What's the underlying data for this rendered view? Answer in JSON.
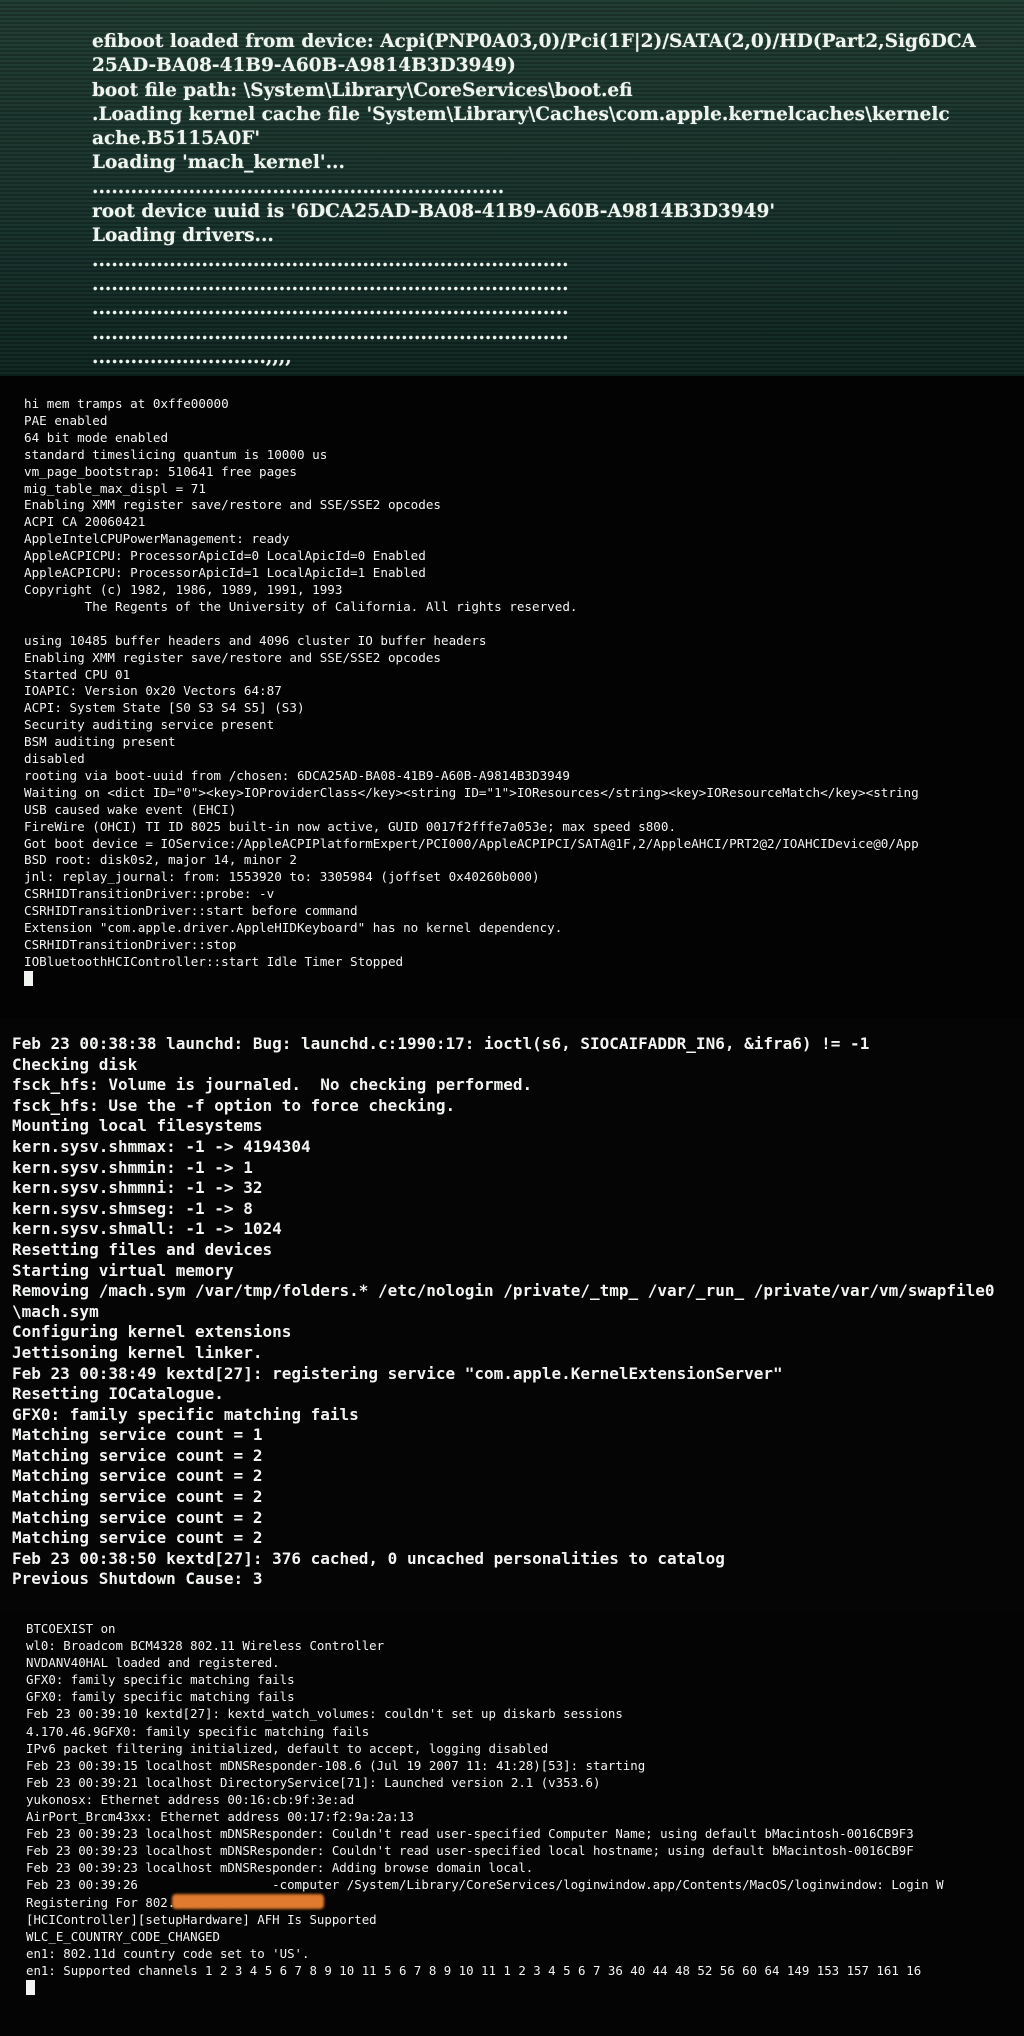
{
  "efi_boot": {
    "lines": [
      "efiboot loaded from device: Acpi(PNP0A03,0)/Pci(1F|2)/SATA(2,0)/HD(Part2,Sig6DCA",
      "25AD-BA08-41B9-A60B-A9814B3D3949)",
      "boot file path: \\System\\Library\\CoreServices\\boot.efi",
      ".Loading kernel cache file 'System\\Library\\Caches\\com.apple.kernelcaches\\kernelc",
      "ache.B5115A0F'",
      "Loading 'mach_kernel'...",
      "................................................................",
      "root device uuid is '6DCA25AD-BA08-41B9-A60B-A9814B3D3949'",
      "Loading drivers...",
      "..........................................................................",
      "..........................................................................",
      "..........................................................................",
      "..........................................................................",
      "...........................,,,,"
    ]
  },
  "kernel_log": {
    "lines": [
      "hi mem tramps at 0xffe00000",
      "PAE enabled",
      "64 bit mode enabled",
      "standard timeslicing quantum is 10000 us",
      "vm_page_bootstrap: 510641 free pages",
      "mig_table_max_displ = 71",
      "Enabling XMM register save/restore and SSE/SSE2 opcodes",
      "ACPI CA 20060421",
      "AppleIntelCPUPowerManagement: ready",
      "AppleACPICPU: ProcessorApicId=0 LocalApicId=0 Enabled",
      "AppleACPICPU: ProcessorApicId=1 LocalApicId=1 Enabled",
      "Copyright (c) 1982, 1986, 1989, 1991, 1993",
      "        The Regents of the University of California. All rights reserved.",
      "",
      "using 10485 buffer headers and 4096 cluster IO buffer headers",
      "Enabling XMM register save/restore and SSE/SSE2 opcodes",
      "Started CPU 01",
      "IOAPIC: Version 0x20 Vectors 64:87",
      "ACPI: System State [S0 S3 S4 S5] (S3)",
      "Security auditing service present",
      "BSM auditing present",
      "disabled",
      "rooting via boot-uuid from /chosen: 6DCA25AD-BA08-41B9-A60B-A9814B3D3949",
      "Waiting on <dict ID=\"0\"><key>IOProviderClass</key><string ID=\"1\">IOResources</string><key>IOResourceMatch</key><string",
      "USB caused wake event (EHCI)",
      "FireWire (OHCI) TI ID 8025 built-in now active, GUID 0017f2fffe7a053e; max speed s800.",
      "Got boot device = IOService:/AppleACPIPlatformExpert/PCI000/AppleACPIPCI/SATA@1F,2/AppleAHCI/PRT2@2/IOAHCIDevice@0/App",
      "BSD root: disk0s2, major 14, minor 2",
      "jnl: replay_journal: from: 1553920 to: 3305984 (joffset 0x40260b000)",
      "CSRHIDTransitionDriver::probe: -v",
      "CSRHIDTransitionDriver::start before command",
      "Extension \"com.apple.driver.AppleHIDKeyboard\" has no kernel dependency.",
      "CSRHIDTransitionDriver::stop",
      "IOBluetoothHCIController::start Idle Timer Stopped"
    ]
  },
  "launchd_log": {
    "lines": [
      "Feb 23 00:38:38 launchd: Bug: launchd.c:1990:17: ioctl(s6, SIOCAIFADDR_IN6, &ifra6) != -1",
      "Checking disk",
      "fsck_hfs: Volume is journaled.  No checking performed.",
      "fsck_hfs: Use the -f option to force checking.",
      "Mounting local filesystems",
      "kern.sysv.shmmax: -1 -> 4194304",
      "kern.sysv.shmmin: -1 -> 1",
      "kern.sysv.shmmni: -1 -> 32",
      "kern.sysv.shmseg: -1 -> 8",
      "kern.sysv.shmall: -1 -> 1024",
      "Resetting files and devices",
      "Starting virtual memory",
      "Removing /mach.sym /var/tmp/folders.* /etc/nologin /private/_tmp_ /var/_run_ /private/var/vm/swapfile0",
      "\\mach.sym",
      "Configuring kernel extensions",
      "Jettisoning kernel linker.",
      "Feb 23 00:38:49 kextd[27]: registering service \"com.apple.KernelExtensionServer\"",
      "Resetting IOCatalogue.",
      "GFX0: family specific matching fails",
      "Matching service count = 1",
      "Matching service count = 2",
      "Matching service count = 2",
      "Matching service count = 2",
      "Matching service count = 2",
      "Matching service count = 2",
      "Feb 23 00:38:50 kextd[27]: 376 cached, 0 uncached personalities to catalog",
      "Previous Shutdown Cause: 3"
    ]
  },
  "system_log": {
    "lines": [
      "BTCOEXIST on",
      "wl0: Broadcom BCM4328 802.11 Wireless Controller",
      "NVDANV40HAL loaded and registered.",
      "GFX0: family specific matching fails",
      "GFX0: family specific matching fails",
      "Feb 23 00:39:10 kextd[27]: kextd_watch_volumes: couldn't set up diskarb sessions",
      "4.170.46.9GFX0: family specific matching fails",
      "IPv6 packet filtering initialized, default to accept, logging disabled",
      "Feb 23 00:39:15 localhost mDNSResponder-108.6 (Jul 19 2007 11: 41:28)[53]: starting",
      "Feb 23 00:39:21 localhost DirectoryService[71]: Launched version 2.1 (v353.6)",
      "yukonosx: Ethernet address 00:16:cb:9f:3e:ad",
      "AirPort_Brcm43xx: Ethernet address 00:17:f2:9a:2a:13",
      "Feb 23 00:39:23 localhost mDNSResponder: Couldn't read user-specified Computer Name; using default bMacintosh-0016CB9F3",
      "Feb 23 00:39:23 localhost mDNSResponder: Couldn't read user-specified local hostname; using default bMacintosh-0016CB9F",
      "Feb 23 00:39:23 localhost mDNSResponder: Adding browse domain local.",
      "Feb 23 00:39:26                  -computer /System/Library/CoreServices/loginwindow.app/Contents/MacOS/loginwindow: Login W",
      "Registering For 802.11 Events",
      "[HCIController][setupHardware] AFH Is Supported",
      "WLC_E_COUNTRY_CODE_CHANGED",
      "en1: 802.11d country code set to 'US'.",
      "en1: Supported channels 1 2 3 4 5 6 7 8 9 10 11 5 6 7 8 9 10 11 1 2 3 4 5 6 7 36 40 44 48 52 56 60 64 149 153 157 161 16"
    ]
  }
}
